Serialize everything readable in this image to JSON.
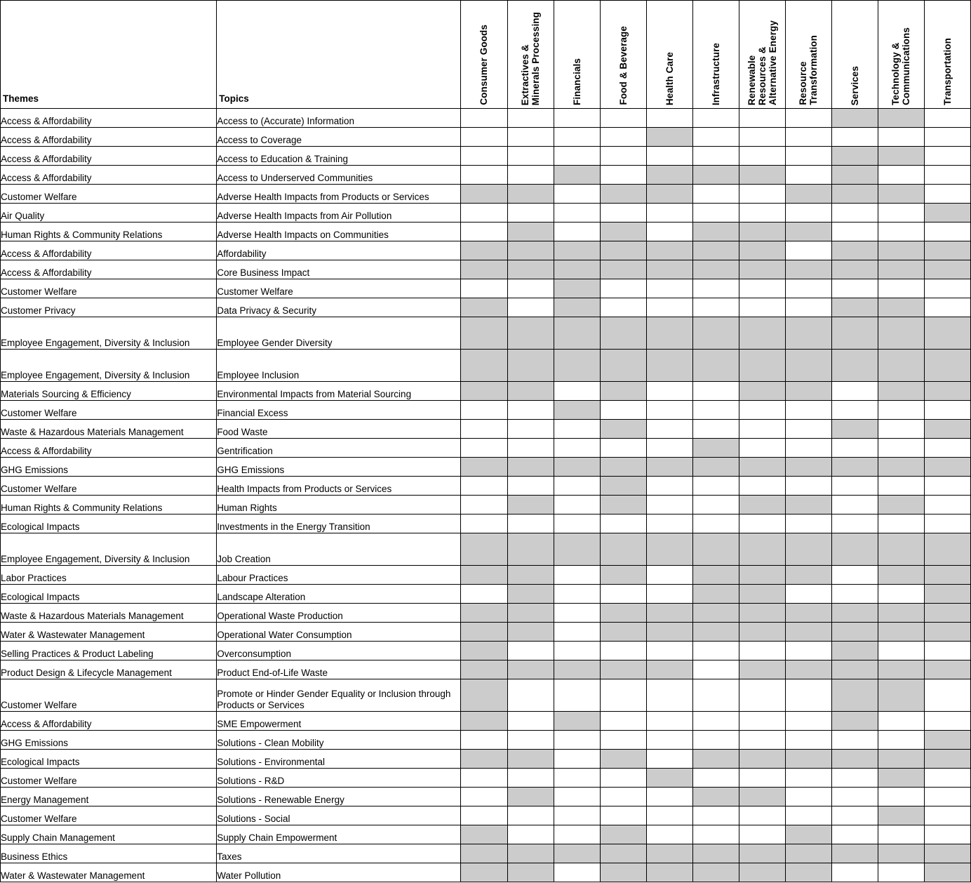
{
  "table": {
    "headers": {
      "theme": "Themes",
      "topic": "Topics",
      "sectors": [
        "Consumer Goods",
        "Extractives &\nMinerals Processing",
        "Financials",
        "Food & Beverage",
        "Health Care",
        "Infrastructure",
        "Renewable\nResources &\nAlternative Energy",
        "Resource\nTransformation",
        "Services",
        "Technology &\nCommunications",
        "Transportation"
      ]
    },
    "colors": {
      "marked_cell": "#cccccc",
      "empty_cell": "#ffffff",
      "grid_line": "#000000",
      "text": "#000000"
    },
    "rows": [
      {
        "theme": "Access & Affordability",
        "topic": "Access to (Accurate) Information",
        "marks": [
          0,
          0,
          0,
          0,
          0,
          0,
          0,
          0,
          1,
          1,
          0
        ]
      },
      {
        "theme": "Access & Affordability",
        "topic": "Access to Coverage",
        "marks": [
          0,
          0,
          0,
          0,
          1,
          0,
          0,
          0,
          0,
          0,
          0
        ]
      },
      {
        "theme": "Access & Affordability",
        "topic": "Access to Education & Training",
        "marks": [
          0,
          0,
          0,
          0,
          0,
          0,
          0,
          0,
          1,
          1,
          0
        ]
      },
      {
        "theme": "Access & Affordability",
        "topic": "Access to Underserved Communities",
        "marks": [
          0,
          0,
          1,
          0,
          1,
          1,
          1,
          0,
          1,
          0,
          0
        ]
      },
      {
        "theme": "Customer Welfare",
        "topic": "Adverse Health Impacts from Products or Services",
        "marks": [
          1,
          1,
          0,
          1,
          1,
          0,
          0,
          1,
          1,
          1,
          0
        ]
      },
      {
        "theme": "Air Quality",
        "topic": "Adverse Health Impacts from Air Pollution",
        "marks": [
          0,
          0,
          0,
          0,
          0,
          0,
          0,
          0,
          0,
          0,
          1
        ]
      },
      {
        "theme": "Human Rights & Community Relations",
        "topic": "Adverse Health Impacts on Communities",
        "marks": [
          0,
          1,
          0,
          1,
          0,
          1,
          1,
          1,
          0,
          0,
          0
        ]
      },
      {
        "theme": "Access & Affordability",
        "topic": "Affordability",
        "marks": [
          1,
          1,
          1,
          1,
          1,
          1,
          1,
          0,
          1,
          1,
          1
        ]
      },
      {
        "theme": "Access & Affordability",
        "topic": "Core Business Impact",
        "marks": [
          1,
          1,
          1,
          1,
          1,
          1,
          1,
          1,
          1,
          1,
          1
        ]
      },
      {
        "theme": "Customer Welfare",
        "topic": "Customer Welfare",
        "marks": [
          0,
          0,
          1,
          0,
          0,
          0,
          0,
          0,
          0,
          0,
          0
        ]
      },
      {
        "theme": "Customer Privacy",
        "topic": "Data Privacy & Security",
        "marks": [
          1,
          0,
          1,
          0,
          0,
          0,
          0,
          0,
          1,
          1,
          0
        ]
      },
      {
        "theme": "Employee Engagement, Diversity & Inclusion",
        "topic": "Employee Gender Diversity",
        "marks": [
          1,
          1,
          1,
          1,
          1,
          1,
          1,
          1,
          1,
          1,
          1
        ],
        "tall": true
      },
      {
        "theme": "Employee Engagement, Diversity & Inclusion",
        "topic": "Employee Inclusion",
        "marks": [
          1,
          1,
          1,
          1,
          1,
          1,
          1,
          1,
          1,
          1,
          1
        ],
        "tall": true
      },
      {
        "theme": "Materials Sourcing & Efficiency",
        "topic": "Environmental Impacts from Material Sourcing",
        "marks": [
          1,
          1,
          0,
          1,
          0,
          0,
          1,
          1,
          0,
          1,
          1
        ]
      },
      {
        "theme": "Customer Welfare",
        "topic": "Financial Excess",
        "marks": [
          0,
          0,
          1,
          0,
          0,
          0,
          0,
          0,
          0,
          0,
          0
        ]
      },
      {
        "theme": "Waste & Hazardous Materials Management",
        "topic": "Food Waste",
        "marks": [
          0,
          0,
          0,
          1,
          0,
          0,
          0,
          0,
          1,
          0,
          1
        ]
      },
      {
        "theme": "Access & Affordability",
        "topic": "Gentrification",
        "marks": [
          0,
          0,
          0,
          0,
          0,
          1,
          0,
          0,
          0,
          0,
          0
        ]
      },
      {
        "theme": "GHG Emissions",
        "topic": "GHG Emissions",
        "marks": [
          1,
          1,
          1,
          1,
          1,
          1,
          1,
          1,
          1,
          1,
          1
        ]
      },
      {
        "theme": "Customer Welfare",
        "topic": "Health Impacts from Products or Services",
        "marks": [
          0,
          0,
          0,
          1,
          0,
          0,
          0,
          0,
          0,
          0,
          0
        ]
      },
      {
        "theme": "Human Rights & Community Relations",
        "topic": "Human Rights",
        "marks": [
          0,
          1,
          0,
          1,
          0,
          0,
          1,
          1,
          0,
          1,
          0
        ]
      },
      {
        "theme": "Ecological Impacts",
        "topic": "Investments in the Energy Transition",
        "marks": [
          0,
          0,
          0,
          0,
          0,
          0,
          0,
          0,
          0,
          0,
          0
        ]
      },
      {
        "theme": "Employee Engagement, Diversity & Inclusion",
        "topic": "Job Creation",
        "marks": [
          1,
          1,
          1,
          1,
          1,
          1,
          1,
          1,
          1,
          1,
          1
        ],
        "tall": true
      },
      {
        "theme": "Labor Practices",
        "topic": "Labour Practices",
        "marks": [
          1,
          1,
          0,
          1,
          0,
          1,
          1,
          1,
          0,
          1,
          1
        ]
      },
      {
        "theme": "Ecological Impacts",
        "topic": "Landscape Alteration",
        "marks": [
          0,
          1,
          0,
          0,
          0,
          1,
          1,
          0,
          0,
          0,
          1
        ]
      },
      {
        "theme": "Waste & Hazardous Materials Management",
        "topic": "Operational Waste Production",
        "marks": [
          1,
          1,
          0,
          1,
          1,
          1,
          1,
          1,
          1,
          1,
          1
        ]
      },
      {
        "theme": "Water & Wastewater Management",
        "topic": "Operational Water Consumption",
        "marks": [
          1,
          1,
          0,
          1,
          1,
          1,
          1,
          1,
          1,
          1,
          1
        ]
      },
      {
        "theme": "Selling Practices & Product Labeling",
        "topic": "Overconsumption",
        "marks": [
          1,
          0,
          0,
          0,
          0,
          0,
          0,
          0,
          1,
          0,
          0
        ]
      },
      {
        "theme": "Product Design & Lifecycle Management",
        "topic": "Product End-of-Life Waste",
        "marks": [
          1,
          1,
          1,
          1,
          1,
          0,
          1,
          1,
          1,
          1,
          1
        ]
      },
      {
        "theme": "Customer Welfare",
        "topic": "Promote or Hinder Gender Equality or Inclusion through Products or Services",
        "marks": [
          1,
          0,
          0,
          0,
          0,
          0,
          0,
          0,
          1,
          1,
          0
        ],
        "tall": true
      },
      {
        "theme": "Access & Affordability",
        "topic": "SME Empowerment",
        "marks": [
          1,
          0,
          1,
          0,
          0,
          0,
          0,
          0,
          1,
          0,
          0
        ]
      },
      {
        "theme": "GHG Emissions",
        "topic": "Solutions - Clean Mobility",
        "marks": [
          0,
          0,
          0,
          0,
          0,
          0,
          0,
          0,
          0,
          0,
          1
        ]
      },
      {
        "theme": "Ecological Impacts",
        "topic": "Solutions - Environmental",
        "marks": [
          1,
          1,
          0,
          1,
          0,
          1,
          1,
          1,
          1,
          1,
          1
        ]
      },
      {
        "theme": "Customer Welfare",
        "topic": "Solutions - R&D",
        "marks": [
          0,
          0,
          0,
          0,
          1,
          0,
          0,
          0,
          0,
          1,
          0
        ]
      },
      {
        "theme": "Energy Management",
        "topic": "Solutions - Renewable Energy",
        "marks": [
          0,
          1,
          0,
          0,
          0,
          1,
          1,
          0,
          0,
          0,
          0
        ]
      },
      {
        "theme": "Customer Welfare",
        "topic": "Solutions - Social",
        "marks": [
          0,
          0,
          0,
          0,
          0,
          0,
          0,
          0,
          0,
          1,
          0
        ]
      },
      {
        "theme": "Supply Chain Management",
        "topic": "Supply Chain Empowerment",
        "marks": [
          1,
          0,
          0,
          1,
          0,
          0,
          0,
          1,
          0,
          0,
          0
        ]
      },
      {
        "theme": "Business Ethics",
        "topic": "Taxes",
        "marks": [
          1,
          1,
          1,
          1,
          1,
          1,
          1,
          1,
          1,
          1,
          1
        ]
      },
      {
        "theme": "Water & Wastewater Management",
        "topic": "Water Pollution",
        "marks": [
          1,
          1,
          0,
          1,
          1,
          1,
          1,
          1,
          0,
          0,
          1
        ]
      }
    ]
  }
}
